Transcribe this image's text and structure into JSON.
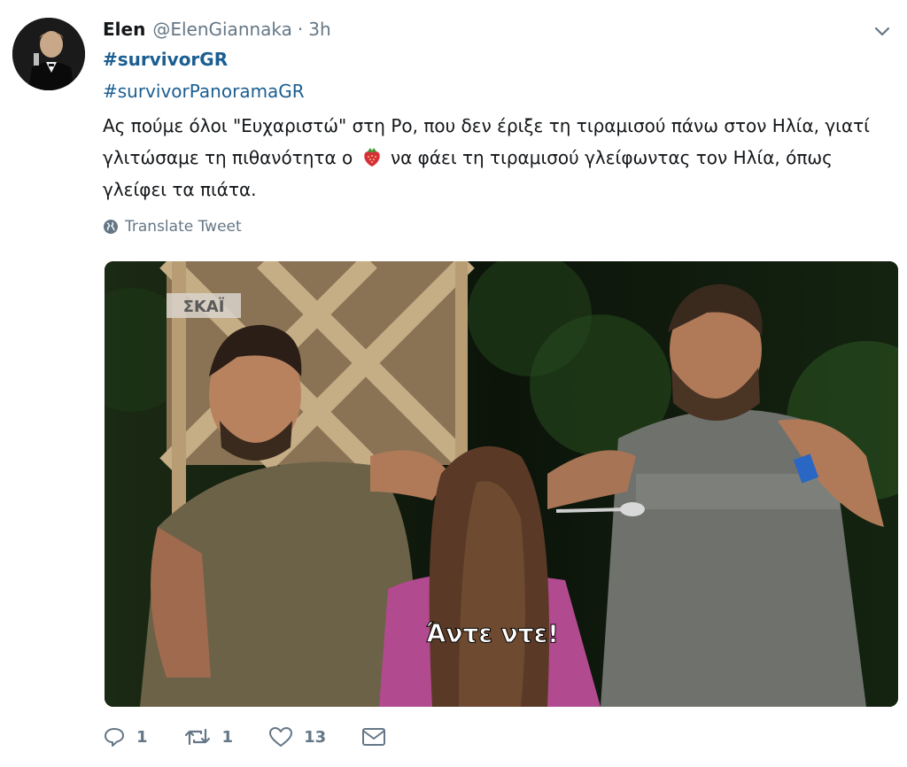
{
  "tweet": {
    "display_name": "Elen",
    "handle": "@ElenGiannaka",
    "separator": "·",
    "time": "3h",
    "hashtags": [
      "#survivorGR",
      "#survivorPanoramaGR"
    ],
    "text_part1": "Ας πούμε όλοι \"Ευχαριστώ\" στη Ρο, που δεν έριξε τη τιραμισού πάνω στον Ηλία, γιατί γλιτώσαμε τη πιθανότητα ο ",
    "text_part2": " να φάει τη τιραμισού γλείφωντας τον Ηλία, όπως γλείφει τα πιάτα.",
    "emoji": "strawberry-icon",
    "translate_label": "Translate Tweet"
  },
  "media": {
    "channel_logo": "ΣΚΑΪ",
    "subtitle": "Άντε ντε!"
  },
  "actions": {
    "replies": "1",
    "retweets": "1",
    "likes": "13"
  },
  "colors": {
    "link": "#1b5e91",
    "muted": "#657786",
    "text": "#14171a"
  }
}
